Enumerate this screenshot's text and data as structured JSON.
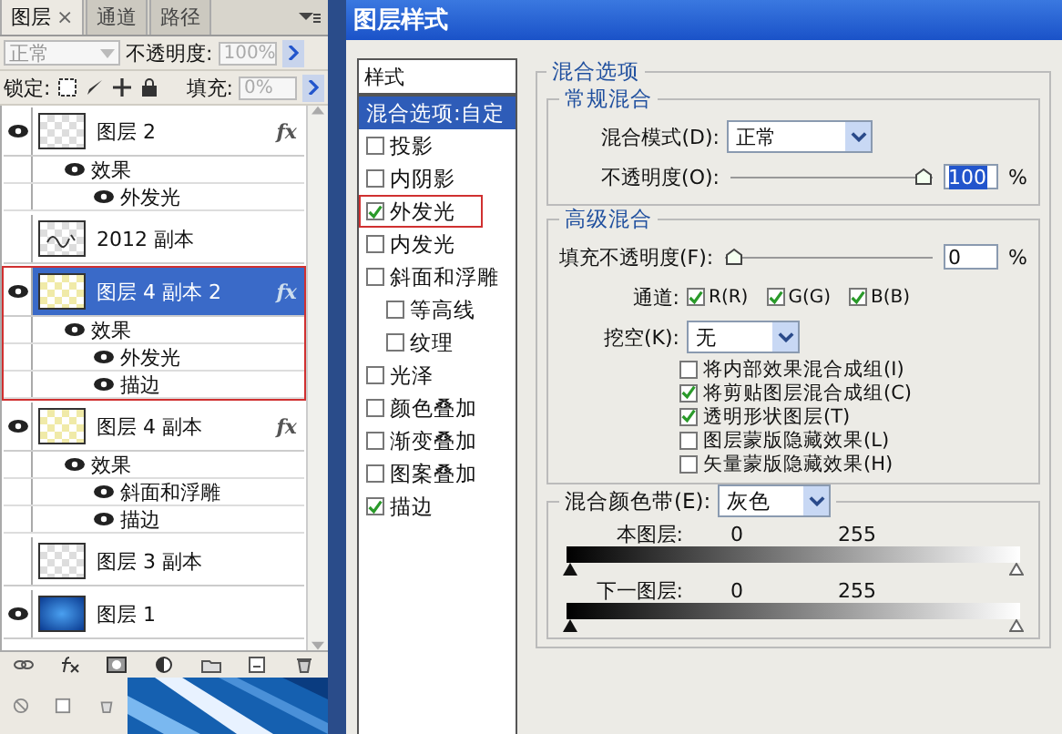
{
  "layers_panel": {
    "tabs": [
      {
        "label": "图层",
        "selected": true,
        "close": "×"
      },
      {
        "label": "通道",
        "selected": false
      },
      {
        "label": "路径",
        "selected": false
      }
    ],
    "blend_mode": "正常",
    "opacity_label": "不透明度:",
    "opacity": "100%",
    "lock_label": "锁定:",
    "fill_label": "填充:",
    "fill": "0%",
    "layers": [
      {
        "name": "图层 2",
        "kind": "transparent",
        "fx": "fx",
        "visible": true,
        "selected": false,
        "highlighted": false,
        "effects_label": "效果",
        "effects": [
          "外发光"
        ]
      },
      {
        "name": "2012 副本",
        "kind": "text",
        "visible": false,
        "selected": false,
        "highlighted": false
      },
      {
        "name": "图层 4 副本 2",
        "kind": "yellow",
        "fx": "fx",
        "visible": true,
        "selected": true,
        "highlighted": true,
        "effects_label": "效果",
        "effects": [
          "外发光",
          "描边"
        ]
      },
      {
        "name": "图层 4 副本",
        "kind": "yellow",
        "fx": "fx",
        "visible": true,
        "selected": false,
        "highlighted": false,
        "effects_label": "效果",
        "effects": [
          "斜面和浮雕",
          "描边"
        ]
      },
      {
        "name": "图层 3 副本",
        "kind": "transparent",
        "visible": false,
        "selected": false,
        "highlighted": false
      },
      {
        "name": "图层 1",
        "kind": "blue",
        "visible": true,
        "selected": false,
        "highlighted": false
      }
    ]
  },
  "dialog": {
    "title": "图层样式",
    "styles_header": "样式",
    "styles": [
      {
        "label": "混合选项:自定",
        "kind": "header",
        "selected": true
      },
      {
        "label": "投影",
        "kind": "check",
        "checked": false,
        "highlighted": false
      },
      {
        "label": "内阴影",
        "kind": "check",
        "checked": false,
        "highlighted": false
      },
      {
        "label": "外发光",
        "kind": "check",
        "checked": true,
        "highlighted": true
      },
      {
        "label": "内发光",
        "kind": "check",
        "checked": false,
        "highlighted": false
      },
      {
        "label": "斜面和浮雕",
        "kind": "check",
        "checked": false,
        "highlighted": false,
        "children": [
          {
            "label": "等高线",
            "checked": false
          },
          {
            "label": "纹理",
            "checked": false
          }
        ]
      },
      {
        "label": "光泽",
        "kind": "check",
        "checked": false,
        "highlighted": false
      },
      {
        "label": "颜色叠加",
        "kind": "check",
        "checked": false,
        "highlighted": false
      },
      {
        "label": "渐变叠加",
        "kind": "check",
        "checked": false,
        "highlighted": false
      },
      {
        "label": "图案叠加",
        "kind": "check",
        "checked": false,
        "highlighted": false
      },
      {
        "label": "描边",
        "kind": "check",
        "checked": true,
        "highlighted": false
      }
    ],
    "blending_options": {
      "title": "混合选项",
      "general": {
        "title": "常规混合",
        "mode_label": "混合模式(D):",
        "mode": "正常",
        "opacity_label": "不透明度(O):",
        "opacity_slider": {
          "level": 1
        },
        "opacity": "100",
        "unit": "%"
      },
      "advanced": {
        "title": "高级混合",
        "fill_label": "填充不透明度(F):",
        "fill_slider": {
          "level": 0
        },
        "fill": "0",
        "unit": "%",
        "channels_label": "通道:",
        "channels": [
          {
            "label": "R(R)",
            "checked": true
          },
          {
            "label": "G(G)",
            "checked": true
          },
          {
            "label": "B(B)",
            "checked": true
          }
        ],
        "knockout_label": "挖空(K):",
        "knockout": "无",
        "options": [
          {
            "label": "将内部效果混合成组(I)",
            "checked": false
          },
          {
            "label": "将剪贴图层混合成组(C)",
            "checked": true
          },
          {
            "label": "透明形状图层(T)",
            "checked": true
          },
          {
            "label": "图层蒙版隐藏效果(L)",
            "checked": false
          },
          {
            "label": "矢量蒙版隐藏效果(H)",
            "checked": false
          }
        ]
      },
      "blend_if": {
        "label": "混合颜色带(E):",
        "value": "灰色",
        "bands": [
          {
            "label": "本图层:",
            "low": "0",
            "high": "255"
          },
          {
            "label": "下一图层:",
            "low": "0",
            "high": "255"
          }
        ]
      }
    }
  }
}
